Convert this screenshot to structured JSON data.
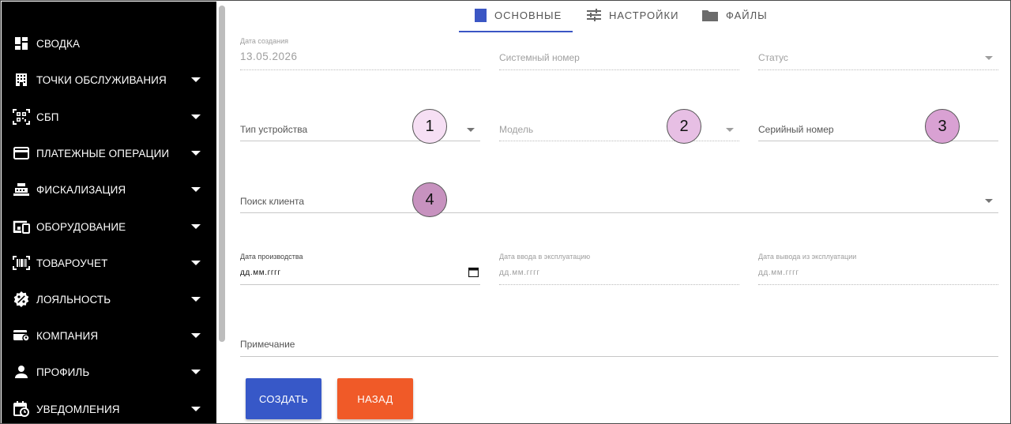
{
  "sidebar": {
    "items": [
      {
        "label": "СВОДКА",
        "icon": "dashboard-icon",
        "has_caret": false
      },
      {
        "label": "ТОЧКИ ОБСЛУЖИВАНИЯ",
        "icon": "building-icon",
        "has_caret": true
      },
      {
        "label": "СБП",
        "icon": "qr-code-icon",
        "has_caret": true
      },
      {
        "label": "ПЛАТЕЖНЫЕ ОПЕРАЦИИ",
        "icon": "credit-card-icon",
        "has_caret": true
      },
      {
        "label": "ФИСКАЛИЗАЦИЯ",
        "icon": "cash-register-icon",
        "has_caret": true
      },
      {
        "label": "ОБОРУДОВАНИЕ",
        "icon": "devices-icon",
        "has_caret": true
      },
      {
        "label": "ТОВАРОУЧЕТ",
        "icon": "barcode-scan-icon",
        "has_caret": true
      },
      {
        "label": "ЛОЯЛЬНОСТЬ",
        "icon": "discount-badge-icon",
        "has_caret": true
      },
      {
        "label": "КОМПАНИЯ",
        "icon": "company-card-icon",
        "has_caret": true
      },
      {
        "label": "ПРОФИЛЬ",
        "icon": "person-icon",
        "has_caret": true
      },
      {
        "label": "УВЕДОМЛЕНИЯ",
        "icon": "calendar-clock-icon",
        "has_caret": true
      }
    ]
  },
  "tabs": [
    {
      "label": "ОСНОВНЫЕ",
      "icon": "square-icon",
      "active": true
    },
    {
      "label": "НАСТРОЙКИ",
      "icon": "sliders-icon",
      "active": false
    },
    {
      "label": "ФАЙЛЫ",
      "icon": "folder-icon",
      "active": false
    }
  ],
  "form": {
    "created_date": {
      "label": "Дата создания",
      "value": "13.05.2026"
    },
    "system_number": {
      "placeholder": "Системный номер"
    },
    "status": {
      "placeholder": "Статус"
    },
    "device_type": {
      "placeholder": "Тип устройства"
    },
    "model": {
      "placeholder": "Модель"
    },
    "serial_number": {
      "placeholder": "Серийный номер"
    },
    "client_search": {
      "placeholder": "Поиск клиента"
    },
    "production_date": {
      "label": "Дата производства",
      "value": "дд.мм.гггг"
    },
    "commission_date": {
      "label": "Дата ввода в эксплуатацию",
      "value": "дд.мм.гггг"
    },
    "decommission_date": {
      "label": "Дата вывода из эксплуатации",
      "value": "дд.мм.гггг"
    },
    "note": {
      "placeholder": "Примечание"
    }
  },
  "markers": [
    "1",
    "2",
    "3",
    "4"
  ],
  "buttons": {
    "create_label": "СОЗДАТЬ",
    "back_label": "НАЗАД"
  },
  "colors": {
    "sidebar_bg": "#000000",
    "accent_blue": "#3b56c4",
    "create_button": "#3758c8",
    "back_button": "#f05a28",
    "marker_1": "#f6dff4",
    "marker_2": "#e7bfe4",
    "marker_3": "#d9a1d3",
    "marker_4": "#c792bf"
  }
}
